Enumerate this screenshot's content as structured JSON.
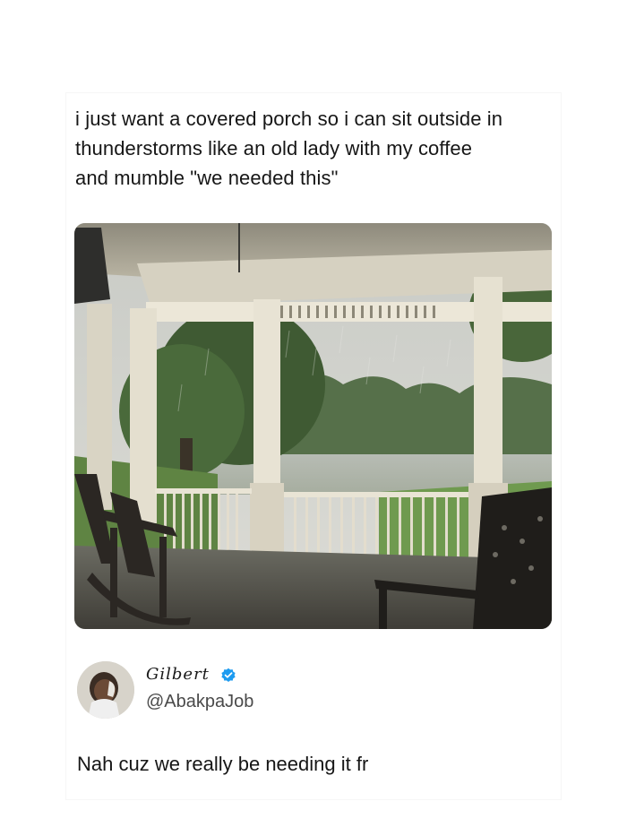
{
  "post": {
    "lines": [
      "i just want a covered porch so i can sit outside in",
      "thunderstorms like an old lady with my coffee",
      "and mumble \"we needed this\""
    ]
  },
  "reply": {
    "author": {
      "display_name": "Gilbert",
      "handle": "@AbakpaJob",
      "verified": true,
      "avatar_icon": "avatar-photo"
    },
    "text": "Nah cuz we really be needing it fr"
  },
  "colors": {
    "verified_badge": "#1d9bf0",
    "text": "#161616"
  }
}
